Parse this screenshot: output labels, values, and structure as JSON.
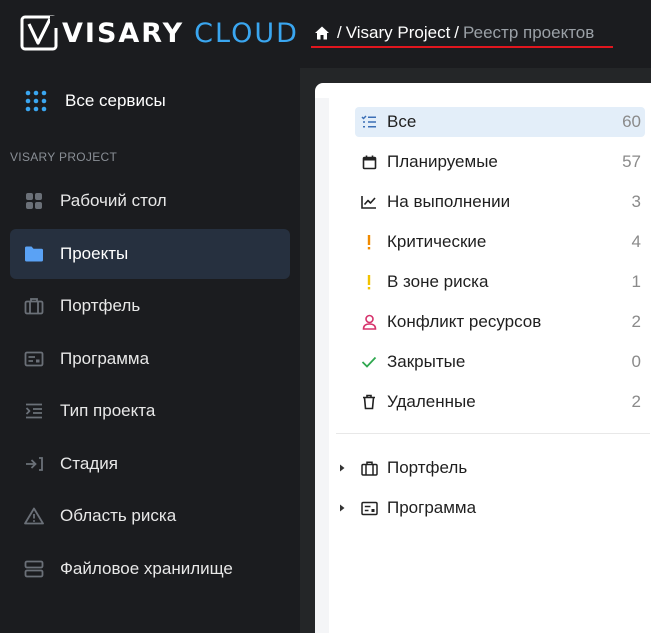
{
  "header": {
    "logo_brand": "VISARY",
    "logo_product": "CLOUD",
    "breadcrumb": {
      "home_icon": "home-icon",
      "project": "Visary Project",
      "current": "Реестр проектов",
      "separator": "/"
    }
  },
  "sidebar": {
    "all_services": "Все сервисы",
    "section_label": "VISARY PROJECT",
    "items": [
      {
        "label": "Рабочий стол",
        "icon": "dashboard-icon"
      },
      {
        "label": "Проекты",
        "icon": "folder-icon",
        "active": true
      },
      {
        "label": "Портфель",
        "icon": "briefcase-icon"
      },
      {
        "label": "Программа",
        "icon": "program-icon"
      },
      {
        "label": "Тип проекта",
        "icon": "indent-list-icon"
      },
      {
        "label": "Стадия",
        "icon": "stage-arrow-icon"
      },
      {
        "label": "Область риска",
        "icon": "warning-icon"
      },
      {
        "label": "Файловое хранилище",
        "icon": "storage-icon"
      }
    ]
  },
  "filters": [
    {
      "label": "Все",
      "count": "60",
      "icon": "checklist-icon",
      "active": true
    },
    {
      "label": "Планируемые",
      "count": "57",
      "icon": "calendar-icon"
    },
    {
      "label": "На выполнении",
      "count": "3",
      "icon": "chart-line-icon"
    },
    {
      "label": "Критические",
      "count": "4",
      "icon": "exclamation-icon",
      "color": "#f08a00"
    },
    {
      "label": "В зоне риска",
      "count": "1",
      "icon": "exclamation-icon",
      "color": "#f2c200"
    },
    {
      "label": "Конфликт ресурсов",
      "count": "2",
      "icon": "person-icon",
      "color": "#d6336c"
    },
    {
      "label": "Закрытые",
      "count": "0",
      "icon": "check-icon",
      "color": "#2fa84f"
    },
    {
      "label": "Удаленные",
      "count": "2",
      "icon": "trash-icon"
    }
  ],
  "tree": [
    {
      "label": "Портфель",
      "icon": "briefcase-icon"
    },
    {
      "label": "Программа",
      "icon": "program-icon"
    }
  ],
  "colors": {
    "accent": "#3aa6f0",
    "breadcrumb_underline": "#e0161e",
    "active_nav_bg": "#26303f",
    "active_filter_bg": "#e3eef9"
  }
}
